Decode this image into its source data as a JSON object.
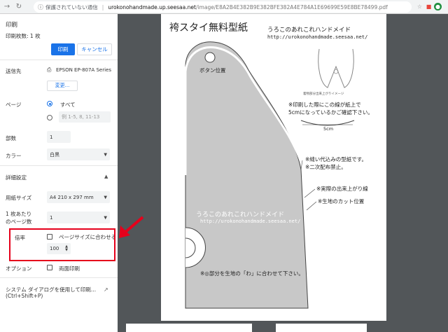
{
  "browser": {
    "security_label": "保護されていない通信",
    "url_host": "urokonohandmade.up.seesaa.net",
    "url_path": "/image/E8A2B4E382B9E382BFE382A4E784A1E69699E59E8BE78499.pdf"
  },
  "print_panel": {
    "title": "印刷",
    "sheet_count": "印刷枚数: 1 枚",
    "print_button": "印刷",
    "cancel_button": "キャンセル",
    "destination_label": "送信先",
    "printer_name": "EPSON EP-807A Series",
    "change_button": "変更...",
    "pages_label": "ページ",
    "pages_all": "すべて",
    "pages_custom_placeholder": "例 1-5, 8, 11-13",
    "copies_label": "部数",
    "copies_value": "1",
    "color_label": "カラー",
    "color_value": "白黒",
    "advanced_label": "詳細設定",
    "paper_size_label": "用紙サイズ",
    "paper_size_value": "A4 210 x 297 mm",
    "pages_per_sheet_label_1": "1 枚あたり",
    "pages_per_sheet_label_2": "のページ数",
    "pages_per_sheet_value": "1",
    "scale_label": "倍率",
    "fit_to_page_label": "ページサイズに合わせる",
    "scale_value": "100",
    "options_label": "オプション",
    "duplex_label": "両面印刷",
    "system_dialog_line1": "システム ダイアログを使用して印刷...",
    "system_dialog_line2": "(Ctrl+Shift+P)"
  },
  "preview": {
    "title": "袴スタイ無料型紙",
    "brand": "うろこのあれこれハンドメイド",
    "brand_url": "http://urokonohandmade.seesaa.net/",
    "button_position": "ボタン位置",
    "finished_image": "着物部分出来上がりイメージ",
    "note_print_check_1": "※印刷した際にこの線が紙上で",
    "note_print_check_2": "5cmになっているかご確認下さい。",
    "measure_5cm": "5cm",
    "note_seam_1": "※縫い代込みの型紙です。",
    "note_seam_2": "※二次配布禁止。",
    "note_finished_line": "※実際の出来上がり線",
    "note_cut_line": "※生地のカット位置",
    "watermark_brand": "うろこのあれこれハンドメイド",
    "watermark_url": "http://urokonohandmade.seesaa.net/",
    "note_fold": "※◎部分を生地の「わ」に合わせて下さい。"
  },
  "colors": {
    "accent": "#1a73e8",
    "highlight": "#e6001b",
    "viewer_bg": "#525659",
    "pattern_fill": "#c8c8c8"
  }
}
